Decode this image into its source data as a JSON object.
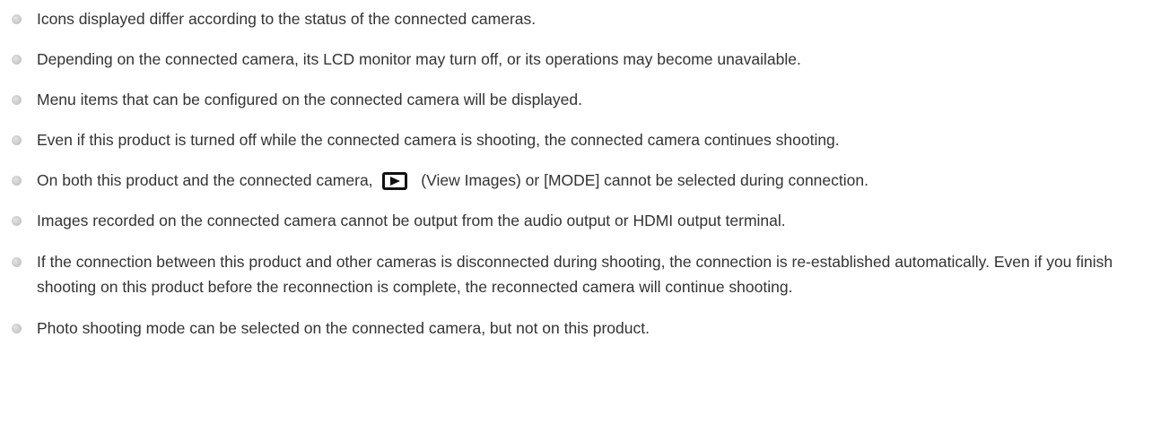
{
  "notes": [
    {
      "text": "Icons displayed differ according to the status of the connected cameras."
    },
    {
      "text": "Depending on the connected camera, its LCD monitor may turn off, or its operations may become unavailable."
    },
    {
      "text": "Menu items that can be configured on the connected camera will be displayed."
    },
    {
      "text": "Even if this product is turned off while the connected camera is shooting, the connected camera continues shooting."
    },
    {
      "before": "On both this product and the connected camera,",
      "icon": "view-images-icon",
      "after": "(View Images) or [MODE] cannot be selected during connection."
    },
    {
      "text": "Images recorded on the connected camera cannot be output from the audio output or HDMI output terminal."
    },
    {
      "text": "If the connection between this product and other cameras is disconnected during shooting, the connection is re-established automatically. Even if you finish shooting on this product before the reconnection is complete, the reconnected camera will continue shooting."
    },
    {
      "text": "Photo shooting mode can be selected on the connected camera, but not on this product."
    }
  ]
}
